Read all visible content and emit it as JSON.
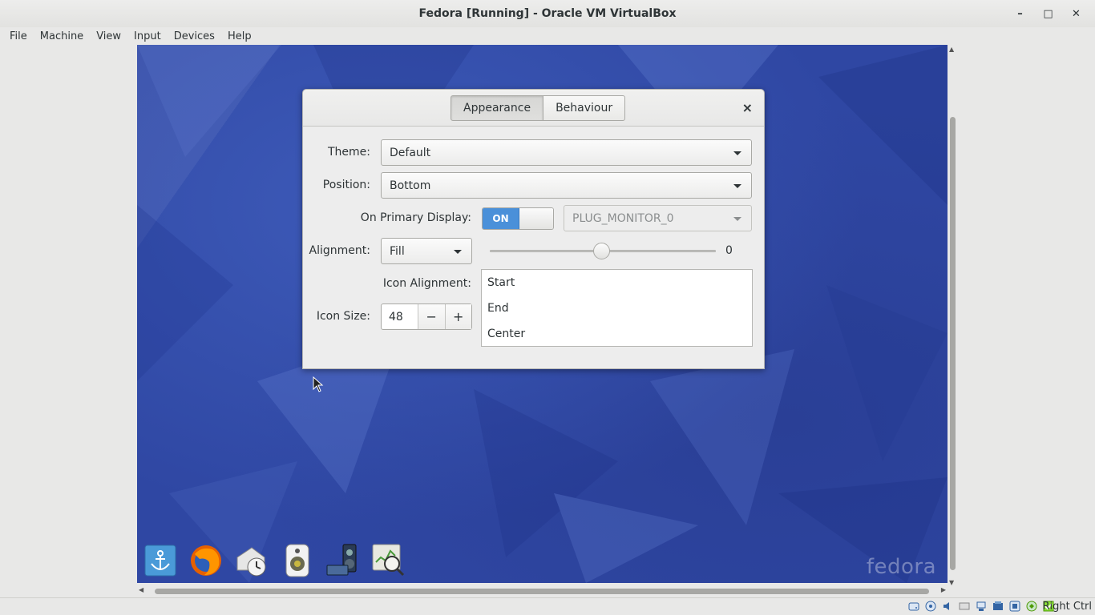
{
  "window": {
    "title": "Fedora [Running] - Oracle VM VirtualBox",
    "minimize": "–",
    "maximize": "□",
    "close": "✕"
  },
  "menubar": [
    "File",
    "Machine",
    "View",
    "Input",
    "Devices",
    "Help"
  ],
  "dialog": {
    "tabs": [
      "Appearance",
      "Behaviour"
    ],
    "active_tab": "Appearance",
    "close": "×",
    "theme": {
      "label": "Theme:",
      "value": "Default"
    },
    "position": {
      "label": "Position:",
      "value": "Bottom"
    },
    "primary_display": {
      "label": "On Primary Display:",
      "switch_state": "ON",
      "monitor": "PLUG_MONITOR_0"
    },
    "alignment": {
      "label": "Alignment:",
      "value": "Fill",
      "slider_value": "0"
    },
    "icon_alignment": {
      "label": "Icon Alignment:",
      "options": [
        "Start",
        "End",
        "Center"
      ]
    },
    "icon_size": {
      "label": "Icon Size:",
      "value": "48",
      "minus": "−",
      "plus": "+"
    }
  },
  "desktop": {
    "logo_text": "fedora",
    "dock_icons": [
      "anchor-launcher-icon",
      "firefox-icon",
      "mail-clock-icon",
      "speaker-icon",
      "media-player-icon",
      "system-monitor-icon"
    ]
  },
  "statusbar": {
    "host_key": "Right Ctrl",
    "icons": [
      "hard-disk-icon",
      "optical-drive-icon",
      "audio-icon",
      "network-icon",
      "usb-icon",
      "shared-folders-icon",
      "display-icon",
      "video-capture-icon",
      "cpu-icon",
      "mouse-integration-icon"
    ]
  },
  "colors": {
    "accent": "#4a90d9",
    "desktop_blue": "#2f47a3"
  }
}
